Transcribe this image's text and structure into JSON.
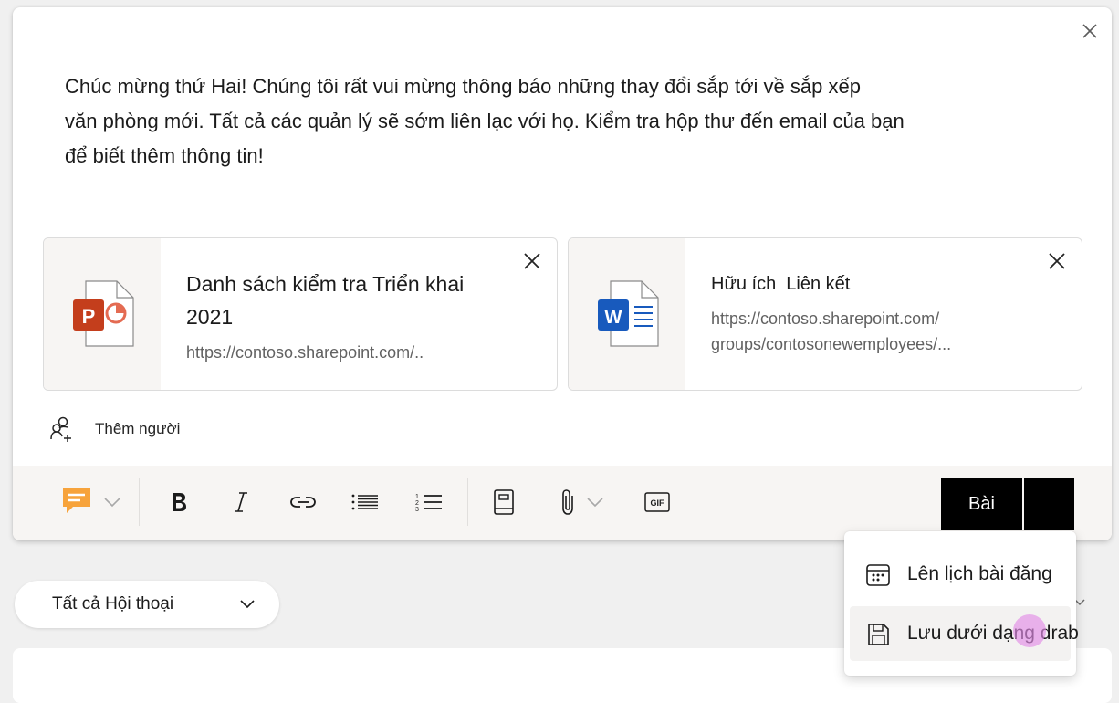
{
  "message": {
    "lines": [
      "Chúc mừng thứ Hai! Chúng tôi rất vui mừng thông báo những thay đổi sắp tới về sắp xếp",
      "văn phòng mới. Tất cả các quản lý sẽ sớm liên lạc với họ. Kiểm tra hộp thư đến email của bạn",
      "để biết thêm thông tin!"
    ]
  },
  "attachments": [
    {
      "type": "powerpoint",
      "icon": "powerpoint-file-icon",
      "title_lines": [
        "Danh sách kiểm tra Triển khai",
        "2021"
      ],
      "url_lines": [
        "https://contoso.sharepoint.com/.."
      ]
    },
    {
      "type": "link",
      "icon": "word-file-icon",
      "title_lines": [
        "Hữu ích  Liên kết"
      ],
      "url_lines": [
        "https://contoso.sharepoint.com/",
        "groups/contosonewemployees/..."
      ]
    }
  ],
  "add_people": {
    "label": "Thêm người"
  },
  "post_button": {
    "label": "Bài"
  },
  "filter": {
    "label": "Tất cả Hội thoại"
  },
  "post_menu": {
    "items": [
      {
        "label": "Lên lịch bài đăng",
        "icon": "calendar-icon"
      },
      {
        "label": "Lưu dưới dạng drab",
        "icon": "save-icon"
      }
    ]
  },
  "colors": {
    "powerpoint": "#c43e1c",
    "word": "#185abd",
    "praise": "#f7a33b",
    "post_button": "#000000"
  }
}
